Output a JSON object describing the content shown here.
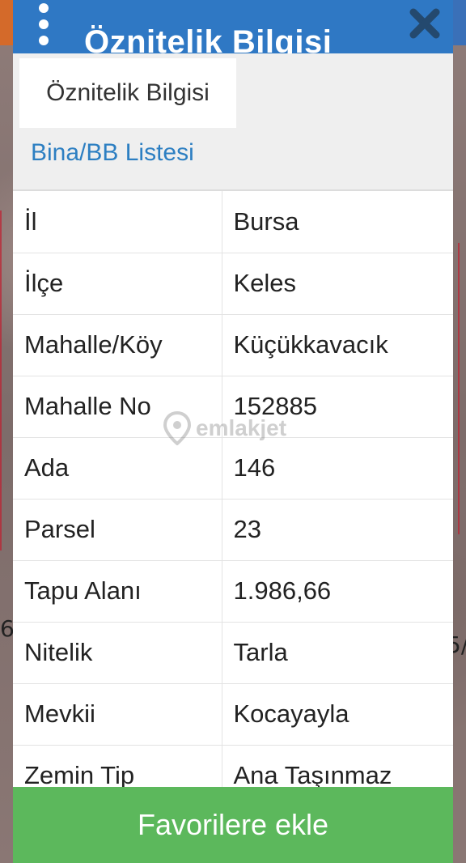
{
  "header": {
    "title": "Öznitelik Bilgisi",
    "menu_icon": "more-vertical-icon",
    "close_icon": "close-icon"
  },
  "tabs": [
    {
      "label": "Öznitelik Bilgisi",
      "active": true
    },
    {
      "label": "Bina/BB Listesi",
      "active": false
    }
  ],
  "attributes": [
    {
      "key": "İl",
      "value": "Bursa"
    },
    {
      "key": "İlçe",
      "value": "Keles"
    },
    {
      "key": "Mahalle/Köy",
      "value": "Küçükkavacık"
    },
    {
      "key": "Mahalle No",
      "value": "152885"
    },
    {
      "key": "Ada",
      "value": "146"
    },
    {
      "key": "Parsel",
      "value": "23"
    },
    {
      "key": "Tapu Alanı",
      "value": "1.986,66"
    },
    {
      "key": "Nitelik",
      "value": "Tarla"
    },
    {
      "key": "Mevkii",
      "value": "Kocayayla"
    },
    {
      "key": "Zemin Tip",
      "value": "Ana Taşınmaz"
    }
  ],
  "watermark": {
    "text": "emlakjet",
    "icon": "location-pin-icon"
  },
  "actions": {
    "favorite_label": "Favorilere ekle"
  },
  "map_labels": {
    "left": "6",
    "right": "5/"
  },
  "colors": {
    "header_bg": "#2f78c4",
    "tab_link": "#2d7fc2",
    "button_bg": "#5cb85c"
  }
}
